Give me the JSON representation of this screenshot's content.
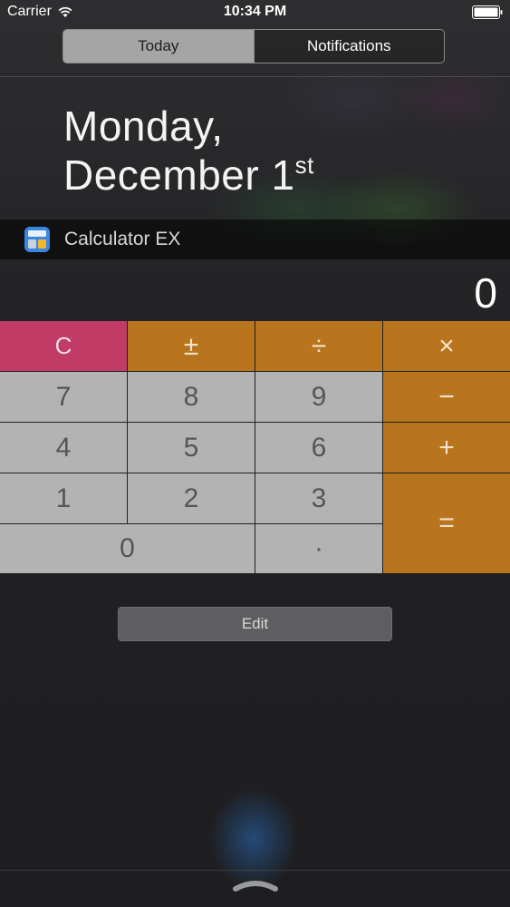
{
  "status_bar": {
    "carrier": "Carrier",
    "time": "10:34 PM"
  },
  "tabs": [
    {
      "label": "Today",
      "selected": true
    },
    {
      "label": "Notifications",
      "selected": false
    }
  ],
  "date": {
    "line1": "Monday,",
    "line2": "December 1",
    "suffix": "st"
  },
  "widget": {
    "title": "Calculator EX",
    "display": "0",
    "keys": {
      "clear": "C",
      "plus_minus": "±",
      "divide": "÷",
      "multiply": "×",
      "seven": "7",
      "eight": "8",
      "nine": "9",
      "minus": "−",
      "four": "4",
      "five": "5",
      "six": "6",
      "plus": "+",
      "one": "1",
      "two": "2",
      "three": "3",
      "equals": "=",
      "zero": "0",
      "decimal": "·"
    }
  },
  "edit_label": "Edit",
  "colors": {
    "orange_key": "#b9751e",
    "clear_key": "#c03b66",
    "digit_key": "#b3b3b3"
  },
  "icons": [
    "wifi-icon",
    "battery-icon",
    "calculator-app-icon",
    "grabber-icon"
  ]
}
